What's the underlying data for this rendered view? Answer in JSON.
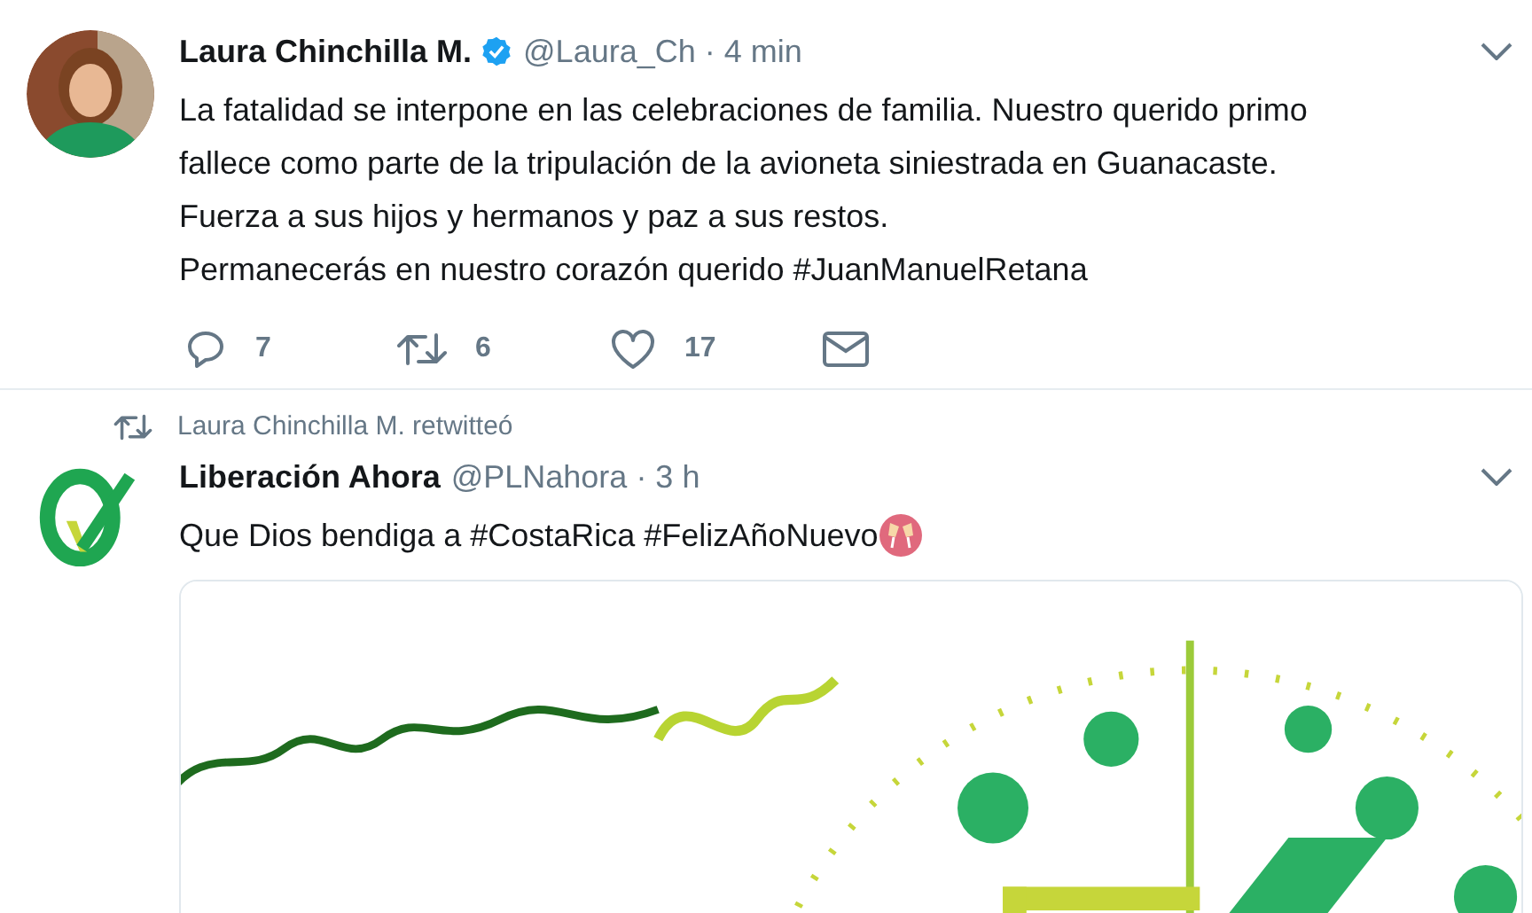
{
  "tweets": [
    {
      "author": "Laura Chinchilla M.",
      "verified": true,
      "handle": "@Laura_Ch",
      "time": "· 4 min",
      "text": "La fatalidad se interpone en las celebraciones de familia. Nuestro querido primo\nfallece como parte de la tripulación de la avioneta siniestrada en Guanacaste.\nFuerza a sus hijos y hermanos y paz a sus restos.\nPermanecerás en nuestro corazón querido #JuanManuelRetana",
      "emoji": false,
      "actions": [
        {
          "kind": "reply",
          "count": "7"
        },
        {
          "kind": "retweet",
          "count": "6"
        },
        {
          "kind": "like",
          "count": "17"
        },
        {
          "kind": "message"
        }
      ]
    },
    {
      "retweeted_by": "Laura Chinchilla M. retwitteó",
      "author": "Liberación Ahora",
      "verified": false,
      "handle": "@PLNahora",
      "time": "· 3 h",
      "avatar": {
        "kind": "logo"
      },
      "text": "Que Dios bendiga a #CostaRica #FelizAñoNuevo",
      "emoji": true
    }
  ]
}
